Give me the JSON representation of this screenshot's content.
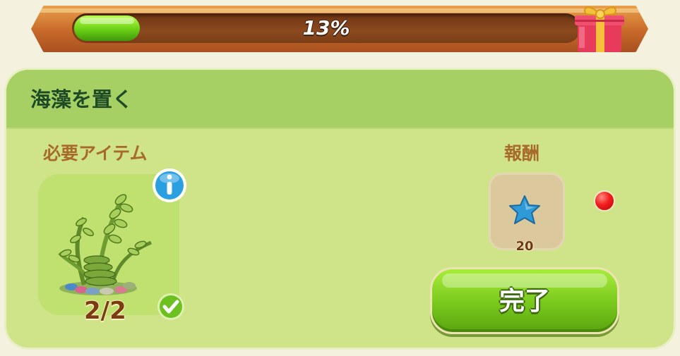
{
  "progress": {
    "percent_text": "13%",
    "fill_fraction": 0.13,
    "reward_icon": "gift-box-icon"
  },
  "task": {
    "title": "海藻を置く",
    "required_label": "必要アイテム",
    "required_item": {
      "icon": "seaweed-icon",
      "count": "2/2",
      "completed": true
    },
    "reward_label": "報酬",
    "reward": {
      "icon": "blue-star-icon",
      "amount": "20"
    },
    "complete_button": "完了",
    "has_notification": true
  },
  "colors": {
    "progress_fill": "#6cd016",
    "panel_bg": "#cfe489",
    "header_bg": "#a6d063",
    "title_text": "#1e4a26",
    "label_text": "#a86a2a",
    "button_green": "#78c81c",
    "notification_red": "#f21c1c",
    "star_blue": "#2f9ad8"
  }
}
